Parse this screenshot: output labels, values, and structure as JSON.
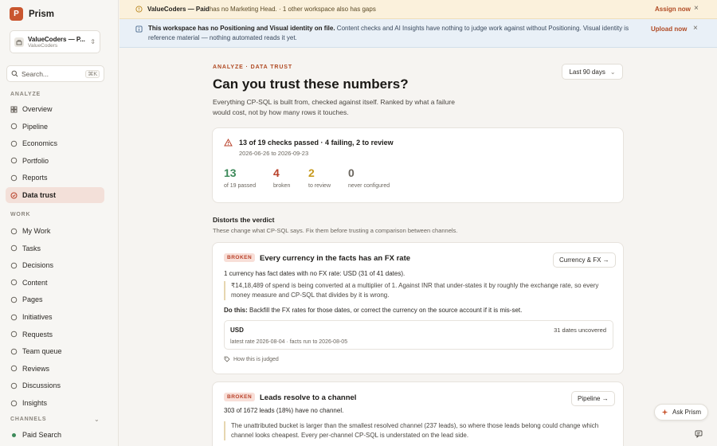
{
  "brand": {
    "name": "Prism",
    "logo_letter": "P"
  },
  "workspace": {
    "name": "ValueCoders — P...",
    "sub": "ValueCoders"
  },
  "search": {
    "placeholder": "Search...",
    "shortcut": "⌘K"
  },
  "sidebar": {
    "analyze_label": "ANALYZE",
    "analyze_items": [
      {
        "label": "Overview",
        "icon": "grid-icon"
      },
      {
        "label": "Pipeline",
        "icon": "pipeline-icon"
      },
      {
        "label": "Economics",
        "icon": "economics-icon"
      },
      {
        "label": "Portfolio",
        "icon": "portfolio-icon"
      },
      {
        "label": "Reports",
        "icon": "reports-icon"
      },
      {
        "label": "Data trust",
        "icon": "data-trust-icon",
        "active": true
      }
    ],
    "work_label": "WORK",
    "work_items": [
      {
        "label": "My Work",
        "icon": "my-work-icon"
      },
      {
        "label": "Tasks",
        "icon": "tasks-icon"
      },
      {
        "label": "Decisions",
        "icon": "decisions-icon"
      },
      {
        "label": "Content",
        "icon": "content-icon"
      },
      {
        "label": "Pages",
        "icon": "pages-icon"
      },
      {
        "label": "Initiatives",
        "icon": "initiatives-icon"
      },
      {
        "label": "Requests",
        "icon": "requests-icon"
      },
      {
        "label": "Team queue",
        "icon": "team-queue-icon"
      },
      {
        "label": "Reviews",
        "icon": "reviews-icon"
      },
      {
        "label": "Discussions",
        "icon": "discussions-icon"
      },
      {
        "label": "Insights",
        "icon": "insights-icon"
      }
    ],
    "channels_label": "CHANNELS",
    "channel_items": [
      {
        "label": "Paid Search",
        "color": "#3d8a5a"
      }
    ]
  },
  "banner_workspace": {
    "strong": "ValueCoders — Paid",
    "text": " has no Marketing Head. · 1 other workspace also has gaps",
    "action": "Assign now",
    "close": "×"
  },
  "banner_positioning": {
    "strong": "This workspace has no Positioning and Visual identity on file.",
    "text": " Content checks and AI Insights have nothing to judge work against without Positioning. Visual identity is reference material — nothing automated reads it yet.",
    "action": "Upload now",
    "close": "×"
  },
  "page": {
    "eyebrow": "ANALYZE · DATA TRUST",
    "title": "Can you trust these numbers?",
    "description": "Everything CP-SQL is built from, checked against itself. Ranked by what a failure would cost, not by how many rows it touches.",
    "range": "Last 90 days"
  },
  "summary": {
    "headline": "13 of 19 checks passed · 4 failing, 2 to review",
    "dates": "2026-06-26 to 2026-09-23",
    "stats": [
      {
        "value": "13",
        "label": "of 19 passed",
        "color": "#3d8a5a"
      },
      {
        "value": "4",
        "label": "broken",
        "color": "#b8412a"
      },
      {
        "value": "2",
        "label": "to review",
        "color": "#c79a1e"
      },
      {
        "value": "0",
        "label": "never configured",
        "color": "#6b665e"
      }
    ]
  },
  "section": {
    "title": "Distorts the verdict",
    "subtitle": "These change what CP-SQL says. Fix them before trusting a comparison between channels."
  },
  "checks": [
    {
      "badge": "BROKEN",
      "title": "Every currency in the facts has an FX rate",
      "button": "Currency & FX →",
      "summary": "1 currency has fact dates with no FX rate: USD (31 of 41 dates).",
      "quote": "₹14,18,489 of spend is being converted at a multiplier of 1. Against INR that under-states it by roughly the exchange rate, so every money measure and CP-SQL that divides by it is wrong.",
      "do_label": "Do this:",
      "do_text": " Backfill the FX rates for those dates, or correct the currency on the source account if it is mis-set.",
      "detail": {
        "currency": "USD",
        "count": "31 dates uncovered",
        "meta": "latest rate 2026-08-04 · facts run to 2026-08-05"
      },
      "judged": "How this is judged"
    },
    {
      "badge": "BROKEN",
      "title": "Leads resolve to a channel",
      "button": "Pipeline →",
      "summary": "303 of 1672 leads (18%) have no channel.",
      "quote": "The unattributed bucket is larger than the smallest resolved channel (237 leads), so where those leads belong could change which channel looks cheapest. Every per-channel CP-SQL is understated on the lead side."
    }
  ],
  "ask": {
    "label": "Ask Prism"
  }
}
